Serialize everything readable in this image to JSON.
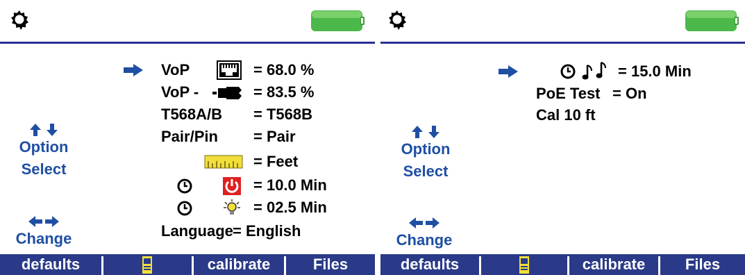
{
  "colors": {
    "accent_blue": "#1f4fa3",
    "softkey_bar": "#2a3a88",
    "divider": "#2a2f8f",
    "battery_green": "#4cb84a",
    "power_red": "#e02020",
    "ruler_yellow": "#f2df3b"
  },
  "left_screen": {
    "hints": {
      "option_select_line1": "Option",
      "option_select_line2": "Select",
      "change": "Change"
    },
    "settings": [
      {
        "label": "VoP",
        "icon": "ethernet-port-icon",
        "value": "= 68.0 %"
      },
      {
        "label": "VoP -",
        "icon": "cable-plug-icon",
        "value": "= 83.5 %"
      },
      {
        "label": "T568A/B",
        "value": "= T568B"
      },
      {
        "label": "Pair/Pin",
        "value": "= Pair"
      },
      {
        "label": "",
        "icon": "ruler-icon",
        "value": "= Feet"
      },
      {
        "label": "",
        "icon": "clock-icon,power-icon",
        "value": "= 10.0 Min"
      },
      {
        "label": "",
        "icon": "clock-icon,bulb-icon",
        "value": "= 02.5 Min"
      },
      {
        "label": "Language",
        "value": "= English"
      }
    ],
    "softkeys": [
      "defaults",
      "",
      "calibrate",
      "Files"
    ]
  },
  "right_screen": {
    "hints": {
      "option_select_line1": "Option",
      "option_select_line2": "Select",
      "change": "Change"
    },
    "settings": [
      {
        "label": "",
        "icon": "clock-icon,music-notes-icon",
        "value": "= 15.0 Min"
      },
      {
        "label": "PoE Test",
        "value": "= On"
      },
      {
        "label": "Cal 10 ft",
        "value": ""
      }
    ],
    "softkeys": [
      "defaults",
      "",
      "calibrate",
      "Files"
    ]
  }
}
